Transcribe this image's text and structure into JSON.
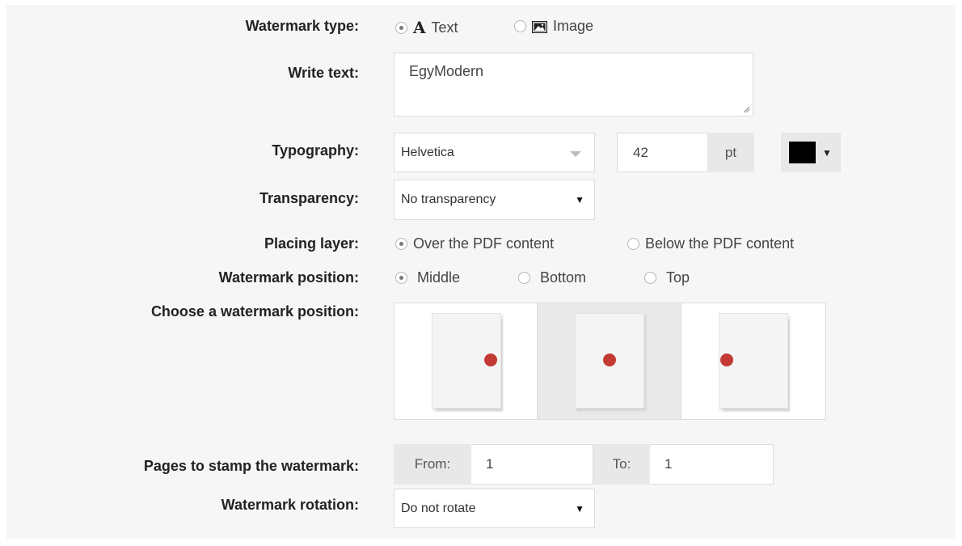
{
  "form": {
    "watermark_type": {
      "label": "Watermark type:",
      "options": [
        {
          "icon": "text-icon",
          "glyph": "A",
          "label": "Text",
          "selected": true
        },
        {
          "icon": "image-icon",
          "label": "Image",
          "selected": false
        }
      ]
    },
    "write_text": {
      "label": "Write text:",
      "value": "EgyModern"
    },
    "typography": {
      "label": "Typography:",
      "font": "Helvetica",
      "size": "42",
      "unit": "pt",
      "color": "#000000"
    },
    "transparency": {
      "label": "Transparency:",
      "value": "No transparency"
    },
    "placing_layer": {
      "label": "Placing layer:",
      "options": [
        {
          "label": "Over the PDF content",
          "selected": true
        },
        {
          "label": "Below the PDF content",
          "selected": false
        }
      ]
    },
    "watermark_position": {
      "label": "Watermark position:",
      "options": [
        {
          "label": "Middle",
          "selected": true
        },
        {
          "label": "Bottom",
          "selected": false
        },
        {
          "label": "Top",
          "selected": false
        }
      ]
    },
    "choose_position": {
      "label": "Choose a watermark position:",
      "options": [
        {
          "name": "right",
          "selected": false
        },
        {
          "name": "center",
          "selected": true
        },
        {
          "name": "left",
          "selected": false
        }
      ],
      "dot_color": "#c33a35"
    },
    "pages": {
      "label": "Pages to stamp the watermark:",
      "from_label": "From:",
      "from_value": "1",
      "to_label": "To:",
      "to_value": "1"
    },
    "rotation": {
      "label": "Watermark rotation:",
      "value": "Do not rotate"
    }
  }
}
